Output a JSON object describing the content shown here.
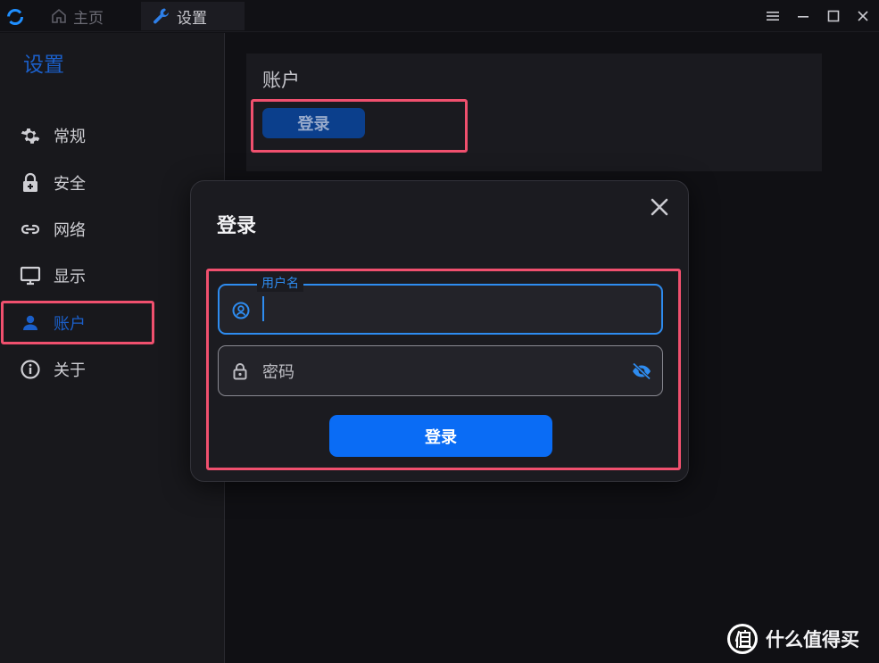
{
  "titlebar": {
    "tabs": [
      {
        "label": "主页",
        "icon": "home-icon",
        "active": false
      },
      {
        "label": "设置",
        "icon": "wrench-icon",
        "active": true
      }
    ],
    "window_controls": [
      "menu-icon",
      "minimize-icon",
      "maximize-icon",
      "close-icon"
    ]
  },
  "sidebar": {
    "title": "设置",
    "items": [
      {
        "label": "常规",
        "icon": "gear-icon",
        "active": false
      },
      {
        "label": "安全",
        "icon": "lock-icon",
        "active": false
      },
      {
        "label": "网络",
        "icon": "link-icon",
        "active": false
      },
      {
        "label": "显示",
        "icon": "monitor-icon",
        "active": false
      },
      {
        "label": "账户",
        "icon": "user-icon",
        "active": true
      },
      {
        "label": "关于",
        "icon": "info-icon",
        "active": false
      }
    ]
  },
  "account_card": {
    "title": "账户",
    "login_label": "登录"
  },
  "login_dialog": {
    "title": "登录",
    "username": {
      "label": "用户名",
      "value": ""
    },
    "password": {
      "placeholder": "密码",
      "value": ""
    },
    "submit_label": "登录"
  },
  "watermark": {
    "text": "什么值得买",
    "logo": "值"
  },
  "colors": {
    "accent": "#0a6cf5",
    "sidebar_active": "#1b5fc9",
    "highlight": "#f0506e",
    "background": "#101014"
  }
}
